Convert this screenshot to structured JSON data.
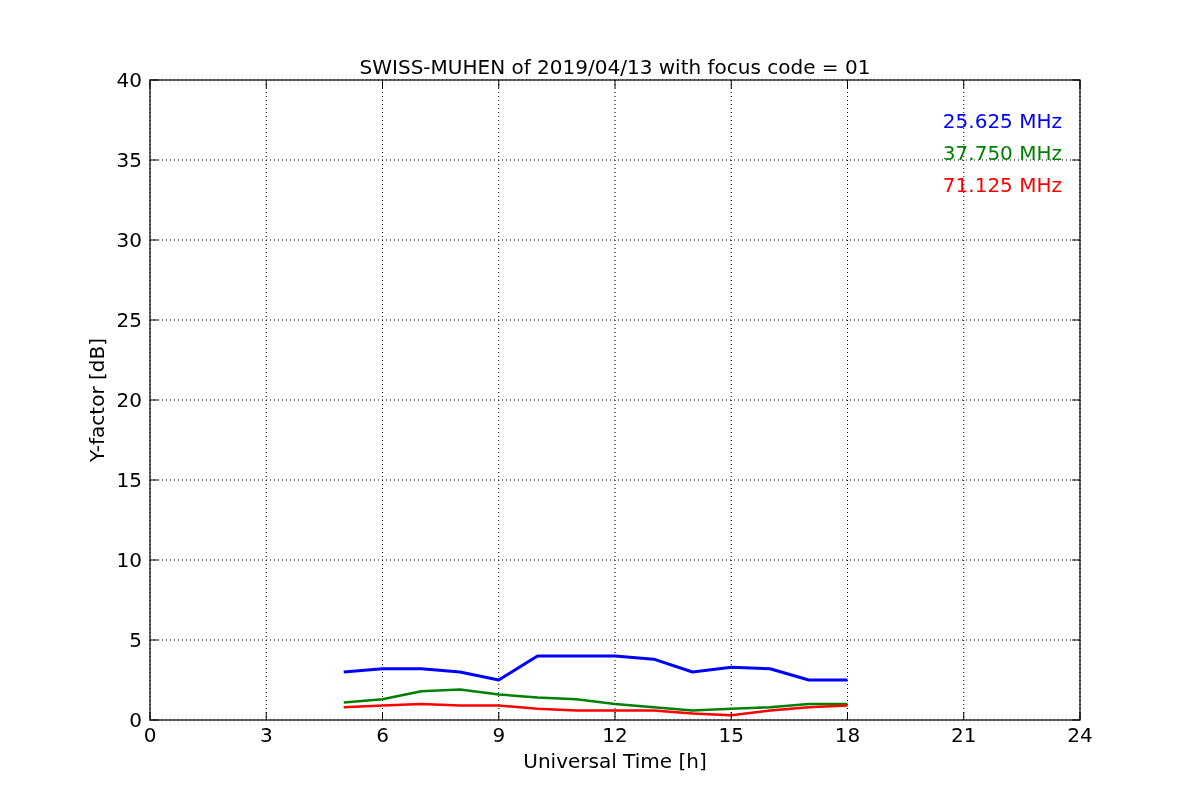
{
  "chart_data": {
    "type": "line",
    "title": "SWISS-MUHEN of 2019/04/13 with focus code = 01",
    "xlabel": "Universal Time [h]",
    "ylabel": "Y-factor [dB]",
    "x": [
      5,
      6,
      7,
      8,
      9,
      10,
      11,
      12,
      13,
      14,
      15,
      16,
      17,
      18
    ],
    "series": [
      {
        "name": "25.625 MHz",
        "color": "#0000ff",
        "values": [
          3,
          3.2,
          3.2,
          3,
          2.5,
          4,
          4,
          4,
          3.8,
          3,
          3.3,
          3.2,
          2.5,
          2.5
        ]
      },
      {
        "name": "37.750 MHz",
        "color": "#008000",
        "values": [
          1.1,
          1.3,
          1.8,
          1.9,
          1.6,
          1.4,
          1.3,
          1.0,
          0.8,
          0.6,
          0.7,
          0.8,
          1.0,
          1.0
        ]
      },
      {
        "name": "71.125 MHz",
        "color": "#ff0000",
        "values": [
          0.8,
          0.9,
          1.0,
          0.9,
          0.9,
          0.7,
          0.6,
          0.6,
          0.6,
          0.4,
          0.3,
          0.6,
          0.8,
          0.9
        ]
      }
    ],
    "xlim": [
      0,
      24
    ],
    "ylim": [
      0,
      40
    ],
    "xticks": [
      0,
      3,
      6,
      9,
      12,
      15,
      18,
      21,
      24
    ],
    "yticks": [
      0,
      5,
      10,
      15,
      20,
      25,
      30,
      35,
      40
    ],
    "grid": true
  }
}
